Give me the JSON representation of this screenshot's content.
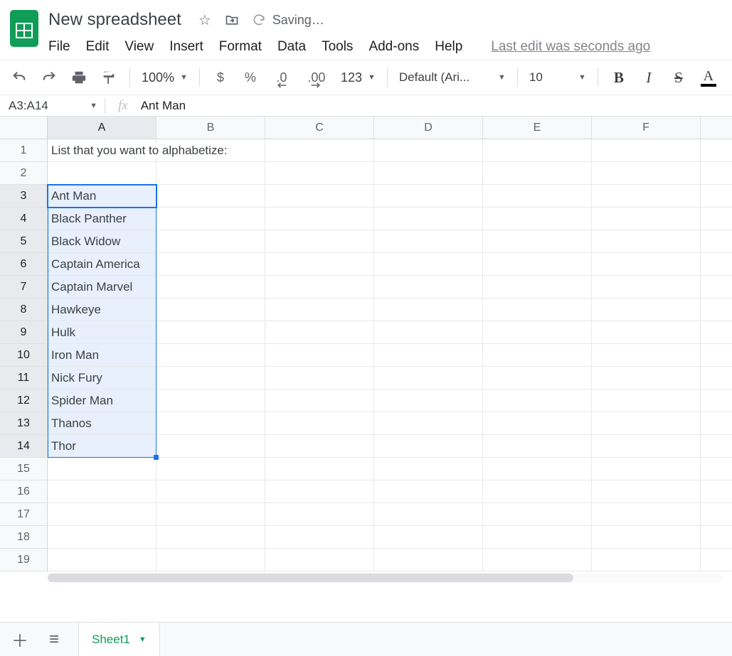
{
  "doc": {
    "title": "New spreadsheet",
    "status": "Saving…",
    "last_edit": "Last edit was seconds ago"
  },
  "menus": [
    "File",
    "Edit",
    "View",
    "Insert",
    "Format",
    "Data",
    "Tools",
    "Add-ons",
    "Help"
  ],
  "toolbar": {
    "zoom": "100%",
    "font": "Default (Ari...",
    "size": "10",
    "currency": "$",
    "percent": "%",
    "dec_dec": ".0",
    "inc_dec": ".00",
    "numfmt": "123"
  },
  "namebox": "A3:A14",
  "formula": "Ant Man",
  "columns": [
    "A",
    "B",
    "C",
    "D",
    "E",
    "F"
  ],
  "rows": 19,
  "selection": {
    "col": "A",
    "row_start": 3,
    "row_end": 14
  },
  "cells": {
    "A1": "List that you want to alphabetize:",
    "A3": "Ant Man",
    "A4": "Black Panther",
    "A5": "Black Widow",
    "A6": "Captain America",
    "A7": "Captain Marvel",
    "A8": "Hawkeye",
    "A9": "Hulk",
    "A10": "Iron Man",
    "A11": "Nick Fury",
    "A12": "Spider Man",
    "A13": "Thanos",
    "A14": "Thor"
  },
  "sheet_tab": "Sheet1"
}
